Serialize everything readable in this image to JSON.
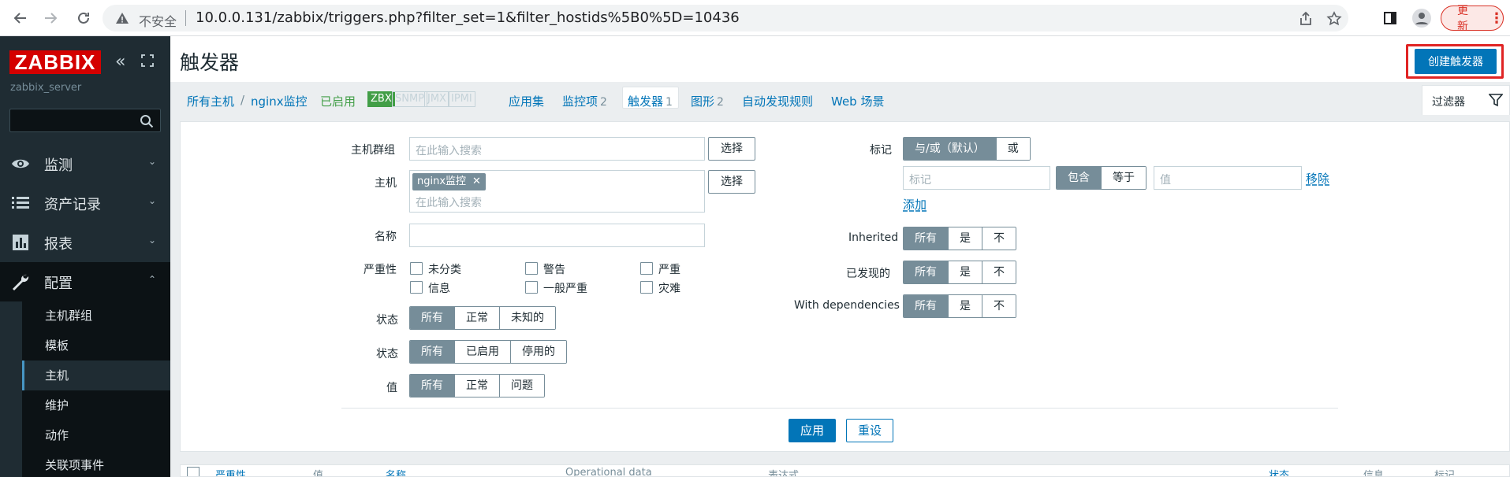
{
  "browser": {
    "insecure_label": "不安全",
    "url": "10.0.0.131/zabbix/triggers.php?filter_set=1&filter_hostids%5B0%5D=10436",
    "update_label": "更新"
  },
  "sidebar": {
    "logo": "ZABBIX",
    "server_name": "zabbix_server",
    "menu": [
      {
        "label": "监测",
        "icon": "eye-icon"
      },
      {
        "label": "资产记录",
        "icon": "list-icon"
      },
      {
        "label": "报表",
        "icon": "bar-chart-icon"
      },
      {
        "label": "配置",
        "icon": "wrench-icon"
      }
    ],
    "submenu": [
      "主机群组",
      "模板",
      "主机",
      "维护",
      "动作",
      "关联项事件"
    ]
  },
  "header": {
    "title": "触发器",
    "create_button": "创建触发器"
  },
  "nav": {
    "all_hosts": "所有主机",
    "separator": "/",
    "host": "nginx监控",
    "enabled": "已启用",
    "availability": [
      "ZBX",
      "SNMP",
      "JMX",
      "IPMI"
    ],
    "apps": "应用集",
    "items": "监控项",
    "items_count": "2",
    "triggers": "触发器",
    "triggers_count": "1",
    "graphs": "图形",
    "graphs_count": "2",
    "discovery": "自动发现规则",
    "web": "Web 场景",
    "filter_tab": "过滤器"
  },
  "filter": {
    "host_group_label": "主机群组",
    "host_label": "主机",
    "search_placeholder": "在此输入搜索",
    "select_button": "选择",
    "host_chip": "nginx监控",
    "chip_close": "✕",
    "name_label": "名称",
    "severity_label": "严重性",
    "severities": [
      "未分类",
      "警告",
      "严重",
      "信息",
      "一般严重",
      "灾难"
    ],
    "state_label": "状态",
    "state_options": [
      "所有",
      "正常",
      "未知的"
    ],
    "status_label": "状态",
    "status_options": [
      "所有",
      "已启用",
      "停用的"
    ],
    "value_label": "值",
    "value_options": [
      "所有",
      "正常",
      "问题"
    ],
    "tags_label": "标记",
    "tag_op_options": [
      "与/或（默认）",
      "或"
    ],
    "tag_placeholder": "标记",
    "tag_cond_options": [
      "包含",
      "等于"
    ],
    "tag_value_placeholder": "值",
    "remove_link": "移除",
    "add_link": "添加",
    "inherited_label": "Inherited",
    "discovered_label": "已发现的",
    "dependencies_label": "With dependencies",
    "tri_options": [
      "所有",
      "是",
      "不"
    ],
    "apply_button": "应用",
    "reset_button": "重设"
  },
  "table": {
    "columns": [
      "严重性",
      "值",
      "名称",
      "Operational data",
      "表达式",
      "状态",
      "信息",
      "标记"
    ]
  }
}
